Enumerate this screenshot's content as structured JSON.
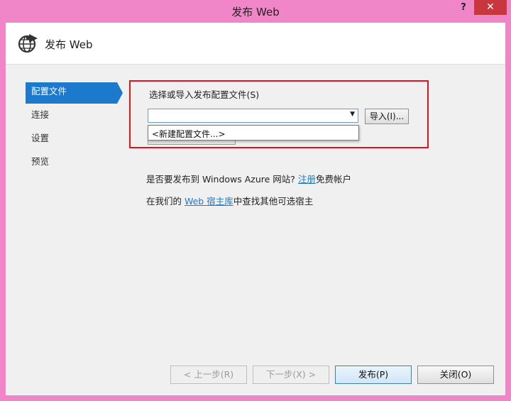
{
  "window": {
    "title": "发布 Web",
    "help_label": "?",
    "close_label": "✕",
    "frame_color": "#f086c8"
  },
  "header": {
    "title": "发布 Web",
    "icon": "globe-publish-icon"
  },
  "nav": {
    "items": [
      {
        "label": "配置文件",
        "active": true
      },
      {
        "label": "连接",
        "active": false
      },
      {
        "label": "设置",
        "active": false
      },
      {
        "label": "预览",
        "active": false
      }
    ],
    "accent_color": "#1c7acc"
  },
  "profile": {
    "label": "选择或导入发布配置文件(S)",
    "combo_value": "",
    "import_label": "导入(I)...",
    "dropdown_item": "<新建配置文件...>",
    "highlight_color": "#e0141a"
  },
  "info": {
    "azure_prefix": "是否要发布到 Windows Azure 网站?",
    "azure_link": "注册",
    "azure_suffix": "免费帐户",
    "hosts_prefix": "在我们的 ",
    "hosts_link": "Web 宿主库",
    "hosts_suffix": "中查找其他可选宿主"
  },
  "footer": {
    "prev_label": "< 上一步(R)",
    "next_label": "下一步(X) >",
    "publish_label": "发布(P)",
    "close_label": "关闭(O)"
  }
}
